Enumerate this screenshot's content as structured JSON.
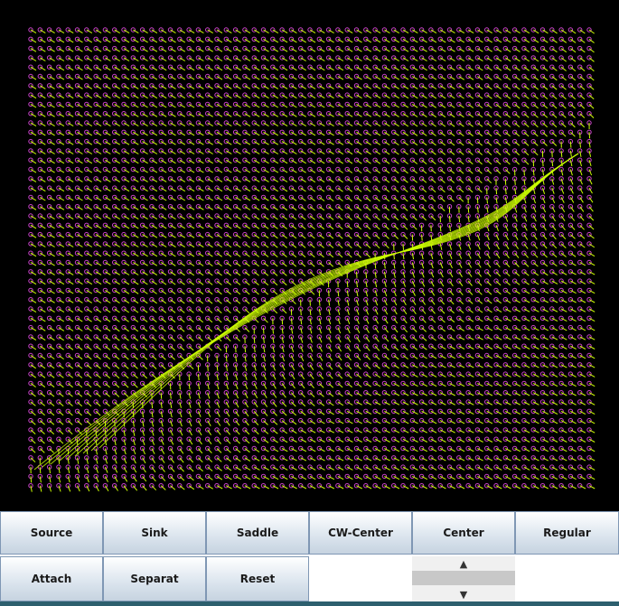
{
  "toolbar": {
    "row1": [
      "Source",
      "Sink",
      "Saddle",
      "CW-Center",
      "Center",
      "Regular"
    ],
    "row2": [
      "Attach",
      "Separat",
      "Reset"
    ]
  },
  "spinner": {
    "up_glyph": "^",
    "down_glyph": "v"
  },
  "colors": {
    "background": "#000000",
    "glyph": "#cc44cc",
    "vector": "#ccff00",
    "separatrix": "#ccff00"
  }
}
